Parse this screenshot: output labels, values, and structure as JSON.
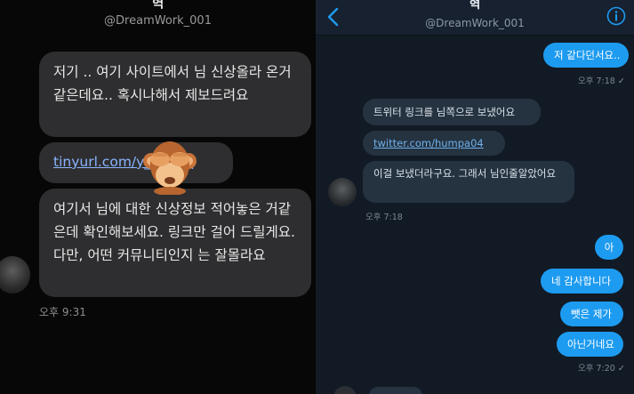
{
  "left_panel": {
    "header": {
      "name": "혁",
      "handle": "@DreamWork_001"
    },
    "messages": [
      {
        "text": "저기 .. 여기 사이트에서 님 신상올라 온거같은데요.. 혹시나해서 제보드려요"
      },
      {
        "link": "tinyurl.com/y______q"
      },
      {
        "text": "여기서 님에 대한 신상정보 적어놓은 거같은데 확인해보세요. 링크만 걸어 드릴게요. 다만, 어떤 커뮤니티인지 는 잘몰라요"
      }
    ],
    "timestamp": "오후 9:31",
    "overlay_icon": "see-no-evil-monkey-emoji"
  },
  "right_panel": {
    "header": {
      "name": "혁",
      "handle": "@DreamWork_001",
      "back_icon": "chevron-left-icon",
      "info_icon": "info-icon"
    },
    "sent_top": {
      "text": "저 같다던서요..",
      "time": "오후 7:18"
    },
    "received": [
      {
        "text": "트위터 링크를 님쪽으로 보냈어요"
      },
      {
        "link": "twitter.com/humpa04"
      },
      {
        "text": "이걸 보냈더라구요. 그래서 님인줄알았어요"
      }
    ],
    "received_time": "오후 7:18",
    "sent_bottom": [
      {
        "text": "아"
      },
      {
        "text": "네 감사합니다"
      },
      {
        "text": "뺏은 제가"
      },
      {
        "text": "아닌거네요"
      }
    ],
    "sent_bottom_time": "오후 7:20",
    "colors": {
      "sent_bubble": "#1d9bf0",
      "received_bubble": "#253341",
      "background": "#121a25"
    }
  }
}
